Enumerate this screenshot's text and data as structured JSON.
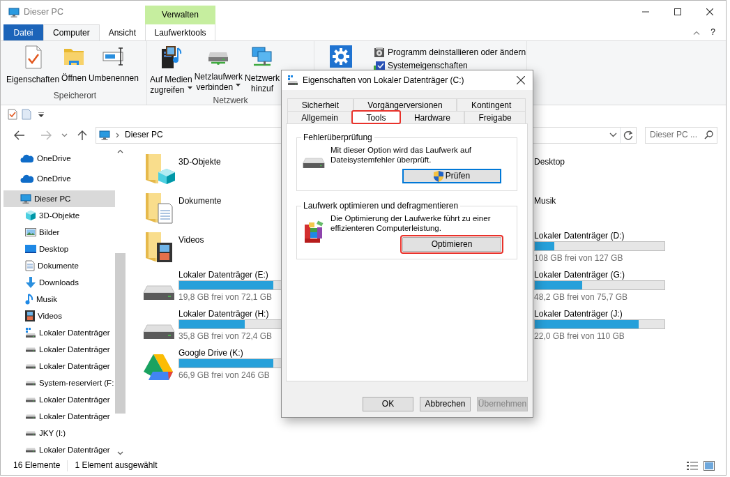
{
  "window": {
    "title": "Dieser PC",
    "context_group": "Verwalten"
  },
  "ribbon_tabs": [
    {
      "label": "Datei",
      "kind": "file",
      "selected": false
    },
    {
      "label": "Computer",
      "kind": "tab",
      "selected": true
    },
    {
      "label": "Ansicht",
      "kind": "tab",
      "selected": false
    },
    {
      "label": "Laufwerktools",
      "kind": "context",
      "selected": false
    }
  ],
  "help_button": "?",
  "ribbon_groups": [
    {
      "label": "Speicherort",
      "commands": [
        {
          "kind": "large",
          "lines": [
            "Eigenschaften"
          ],
          "dropdown": false
        },
        {
          "kind": "large",
          "lines": [
            "Öffnen"
          ],
          "dropdown": false
        },
        {
          "kind": "large",
          "lines": [
            "Umbenennen"
          ],
          "dropdown": false
        }
      ]
    },
    {
      "label": "Netzwerk",
      "commands": [
        {
          "kind": "large",
          "lines": [
            "Auf Medien",
            "zugreifen"
          ],
          "dropdown": true
        },
        {
          "kind": "large",
          "lines": [
            "Netzlaufwerk",
            "verbinden"
          ],
          "dropdown": true
        },
        {
          "kind": "large",
          "lines": [
            "Netzwerk",
            "hinzuf"
          ],
          "dropdown": false
        }
      ]
    },
    {
      "commands": [
        {
          "kind": "icon"
        },
        {
          "kind": "small",
          "label": "Programm deinstallieren oder ändern"
        },
        {
          "kind": "small",
          "label": "Systemeigenschaften"
        }
      ]
    }
  ],
  "address": {
    "path": "Dieser PC"
  },
  "search": {
    "placeholder": "Dieser PC ..."
  },
  "nav": [
    {
      "label": "OneDrive",
      "selected": false
    },
    {
      "label": "OneDrive",
      "selected": false
    },
    {
      "label": "Dieser PC",
      "selected": true,
      "children": [
        {
          "label": "3D-Objekte",
          "selected": false
        },
        {
          "label": "Bilder",
          "selected": false
        },
        {
          "label": "Desktop",
          "selected": false
        },
        {
          "label": "Dokumente",
          "selected": false
        },
        {
          "label": "Downloads",
          "selected": false
        },
        {
          "label": "Musik",
          "selected": false
        },
        {
          "label": "Videos",
          "selected": false
        },
        {
          "label": "Lokaler Datenträger",
          "selected": false
        },
        {
          "label": "Lokaler Datenträger",
          "selected": false
        },
        {
          "label": "Lokaler Datenträger",
          "selected": false
        },
        {
          "label": "System-reserviert (F:",
          "selected": false
        },
        {
          "label": "Lokaler Datenträger",
          "selected": false
        },
        {
          "label": "Lokaler Datenträger",
          "selected": false
        },
        {
          "label": "JKY (I:)",
          "selected": false
        },
        {
          "label": "Lokaler Datenträger",
          "selected": false
        }
      ]
    }
  ],
  "tile_columns": [
    {
      "tiles": [
        {
          "kind": "folder",
          "label": "3D-Objekte"
        },
        {
          "kind": "folder",
          "label": "Dokumente"
        },
        {
          "kind": "folder",
          "label": "Videos"
        },
        {
          "kind": "drive",
          "label": "Lokaler Datenträger (E:)",
          "free": "19,8 GB frei von 72,1 GB",
          "level": 0.725
        },
        {
          "kind": "drive",
          "label": "Lokaler Datenträger (H:)",
          "free": "35,8 GB frei von 72,4 GB",
          "level": 0.505
        },
        {
          "kind": "cloud",
          "label": "Google Drive (K:)",
          "free": "66,9 GB frei von 246 GB",
          "level": 0.728
        }
      ]
    },
    {
      "tiles": [
        {
          "kind": "folder",
          "label": "Desktop"
        },
        {
          "kind": "folder",
          "label": "Musik"
        },
        {
          "kind": "drive",
          "label": "Lokaler Datenträger (D:)",
          "free": "108 GB frei von 127 GB",
          "level": 0.15
        },
        {
          "kind": "drive",
          "label": "Lokaler Datenträger (G:)",
          "free": "48,2 GB frei von 75,7 GB",
          "level": 0.363
        },
        {
          "kind": "drive",
          "label": "Lokaler Datenträger (J:)",
          "free": "22,0 GB frei von 110 GB",
          "level": 0.8
        }
      ]
    }
  ],
  "status_bar": {
    "item_count": "16 Elemente",
    "selection": "1 Element ausgewählt"
  },
  "dialog": {
    "title": "Eigenschaften von Lokaler Datenträger (C:)",
    "tab_rows": [
      [
        {
          "label": "Sicherheit",
          "selected": false,
          "highlighted": false
        },
        {
          "label": "Vorgängerversionen",
          "selected": false,
          "highlighted": false
        },
        {
          "label": "Kontingent",
          "selected": false,
          "highlighted": false
        }
      ],
      [
        {
          "label": "Allgemein",
          "selected": false,
          "highlighted": false
        },
        {
          "label": "Tools",
          "selected": true,
          "highlighted": true
        },
        {
          "label": "Hardware",
          "selected": false,
          "highlighted": false
        },
        {
          "label": "Freigabe",
          "selected": false,
          "highlighted": false
        }
      ]
    ],
    "groups": [
      {
        "title": "Fehlerüberprüfung",
        "text": "Mit dieser Option wird das Laufwerk auf Dateisystemfehler überprüft.",
        "button": {
          "label": "Prüfen",
          "shield": true,
          "focused": true,
          "highlighted": false
        }
      },
      {
        "title": "Laufwerk optimieren und defragmentieren",
        "text": "Die Optimierung der Laufwerke führt zu einer effizienteren Computerleistung.",
        "button": {
          "label": "Optimieren",
          "shield": false,
          "focused": false,
          "highlighted": true
        }
      }
    ],
    "buttons": [
      {
        "label": "OK",
        "disabled": false
      },
      {
        "label": "Abbrechen",
        "disabled": false
      },
      {
        "label": "Übernehmen",
        "disabled": true
      }
    ]
  }
}
